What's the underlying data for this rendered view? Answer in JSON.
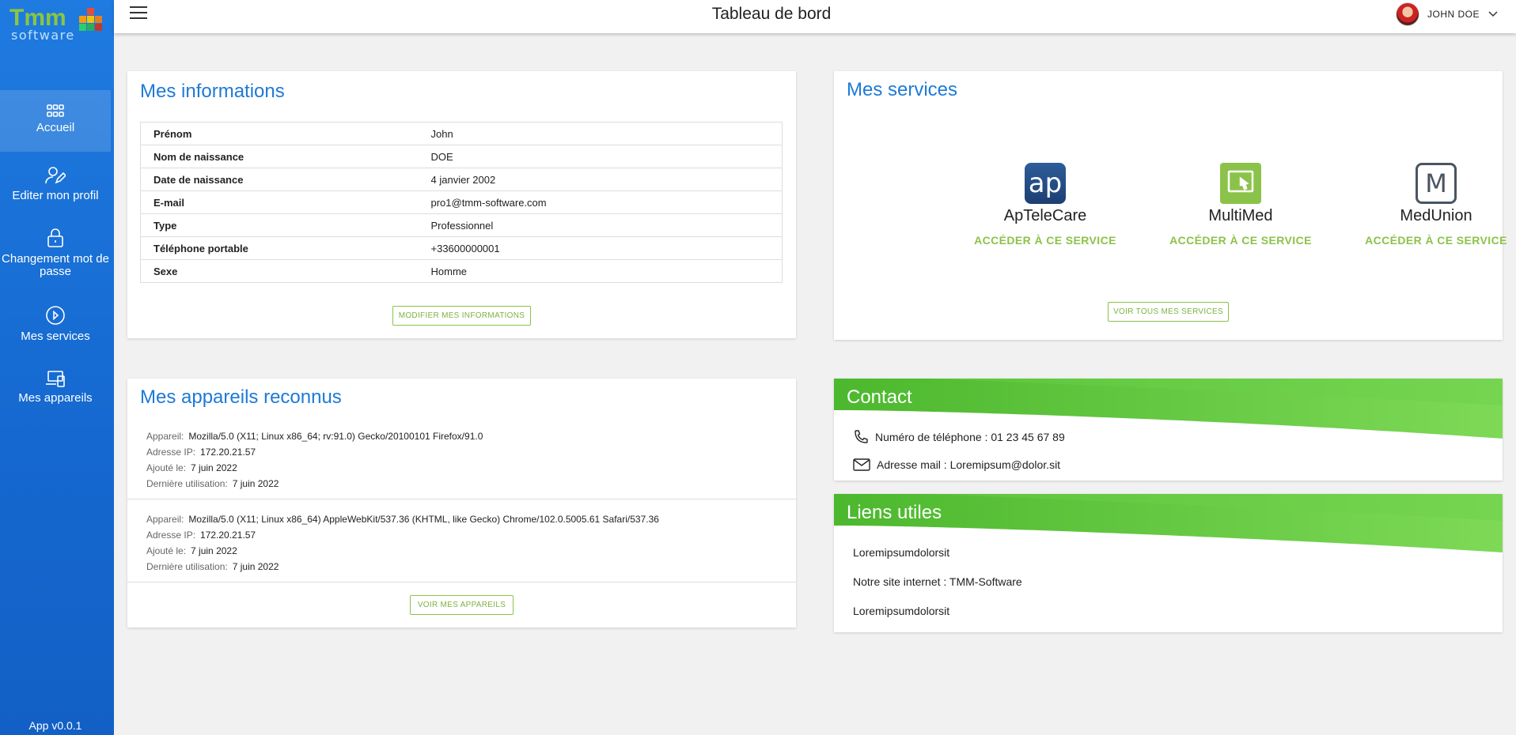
{
  "app": {
    "logo_text": "Tmm",
    "logo_sub": "software",
    "version": "App v0.0.1"
  },
  "sidebar": {
    "items": [
      {
        "label": "Accueil",
        "icon": "grid-icon",
        "active": true
      },
      {
        "label": "Editer mon profil",
        "icon": "user-edit-icon"
      },
      {
        "label": "Changement mot de passe",
        "icon": "lock-icon"
      },
      {
        "label": "Mes services",
        "icon": "play-circle-icon"
      },
      {
        "label": "Mes appareils",
        "icon": "devices-icon"
      }
    ]
  },
  "header": {
    "title": "Tableau de bord",
    "user_name": "JOHN DOE"
  },
  "info": {
    "title": "Mes informations",
    "rows": [
      {
        "key": "Prénom",
        "value": "John"
      },
      {
        "key": "Nom de naissance",
        "value": "DOE"
      },
      {
        "key": "Date de naissance",
        "value": "4 janvier 2002"
      },
      {
        "key": "E-mail",
        "value": "pro1@tmm-software.com"
      },
      {
        "key": "Type",
        "value": "Professionnel"
      },
      {
        "key": "Téléphone portable",
        "value": "+33600000001"
      },
      {
        "key": "Sexe",
        "value": "Homme"
      }
    ],
    "button": "MODIFIER MES INFORMATIONS"
  },
  "services": {
    "title": "Mes services",
    "items": [
      {
        "name": "ApTeleCare",
        "link": "ACCÉDER À CE SERVICE",
        "icon_text": "ap"
      },
      {
        "name": "MultiMed",
        "link": "ACCÉDER À CE SERVICE"
      },
      {
        "name": "MedUnion",
        "link": "ACCÉDER À CE SERVICE",
        "icon_text": "M"
      }
    ],
    "button": "VOIR TOUS MES SERVICES"
  },
  "devices": {
    "title": "Mes appareils reconnus",
    "labels": {
      "device": "Appareil:",
      "ip": "Adresse IP:",
      "added": "Ajouté le:",
      "last": "Dernière utilisation:"
    },
    "items": [
      {
        "device": "Mozilla/5.0 (X11; Linux x86_64; rv:91.0) Gecko/20100101 Firefox/91.0",
        "ip": "172.20.21.57",
        "added": "7 juin 2022",
        "last": "7 juin 2022"
      },
      {
        "device": "Mozilla/5.0 (X11; Linux x86_64) AppleWebKit/537.36 (KHTML, like Gecko) Chrome/102.0.5005.61 Safari/537.36",
        "ip": "172.20.21.57",
        "added": "7 juin 2022",
        "last": "7 juin 2022"
      }
    ],
    "button": "VOIR MES APPAREILS"
  },
  "contact": {
    "title": "Contact",
    "phone": "Numéro de téléphone : 01 23 45 67 89",
    "email": "Adresse mail : Loremipsum@dolor.sit"
  },
  "links": {
    "title": "Liens utiles",
    "items": [
      "Loremipsumdolorsit",
      "Notre site internet : TMM-Software",
      "Loremipsumdolorsit"
    ]
  },
  "colors": {
    "sidebar": "#1a72d9",
    "title_blue": "#1d7ad6",
    "accent_green": "#8bc34a",
    "green_banner": "#5fc23a"
  }
}
